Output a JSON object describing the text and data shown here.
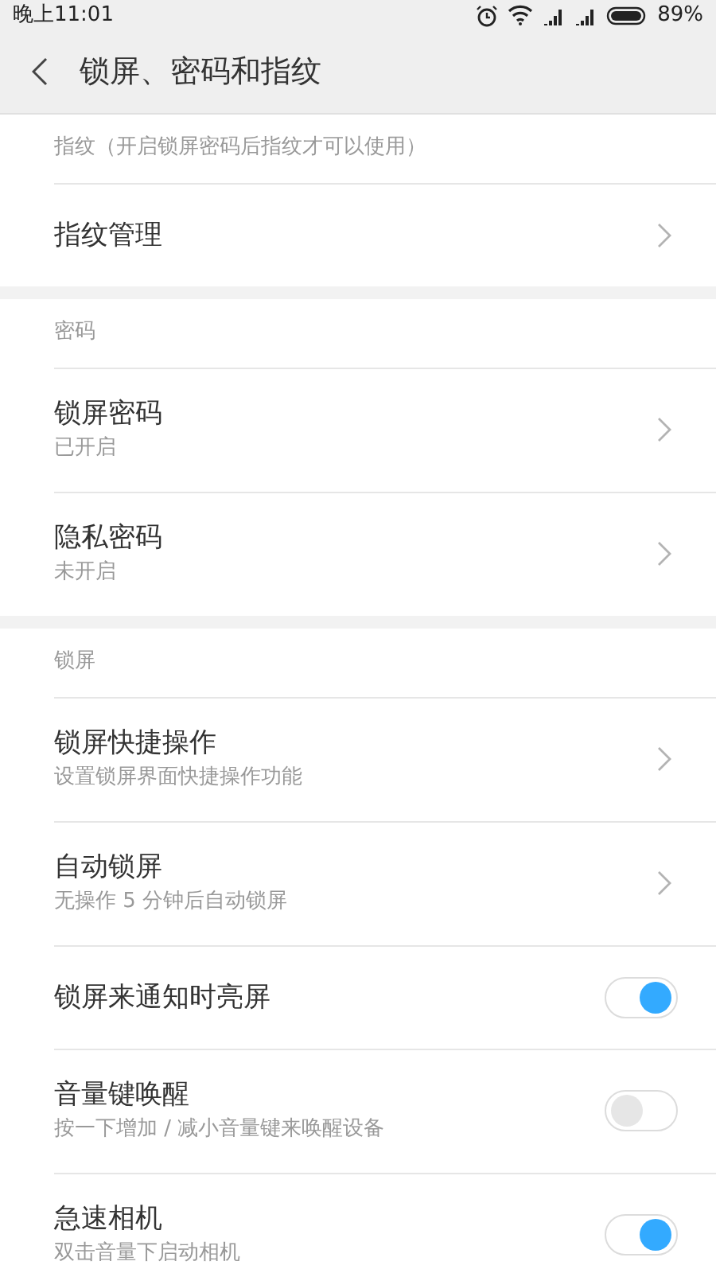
{
  "status_bar": {
    "time": "晚上11:01",
    "battery": "89%"
  },
  "header": {
    "title": "锁屏、密码和指纹"
  },
  "sections": [
    {
      "title": "指纹（开启锁屏密码后指纹才可以使用）",
      "items": [
        {
          "kind": "nav",
          "title": "指纹管理"
        }
      ]
    },
    {
      "title": "密码",
      "items": [
        {
          "kind": "nav",
          "title": "锁屏密码",
          "subtitle": "已开启"
        },
        {
          "kind": "nav",
          "title": "隐私密码",
          "subtitle": "未开启"
        }
      ]
    },
    {
      "title": "锁屏",
      "items": [
        {
          "kind": "nav",
          "title": "锁屏快捷操作",
          "subtitle": "设置锁屏界面快捷操作功能"
        },
        {
          "kind": "nav",
          "title": "自动锁屏",
          "subtitle": "无操作 5 分钟后自动锁屏"
        },
        {
          "kind": "toggle",
          "title": "锁屏来通知时亮屏",
          "on": true
        },
        {
          "kind": "toggle",
          "title": "音量键唤醒",
          "subtitle": "按一下增加 / 减小音量键来唤醒设备",
          "on": false
        },
        {
          "kind": "toggle",
          "title": "急速相机",
          "subtitle": "双击音量下启动相机",
          "on": true
        }
      ]
    }
  ]
}
